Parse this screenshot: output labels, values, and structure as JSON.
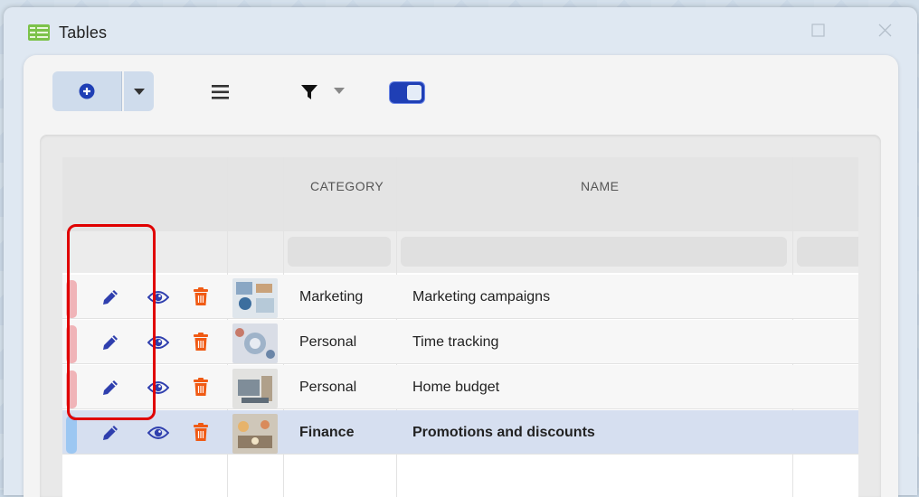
{
  "window": {
    "title": "Tables"
  },
  "grid": {
    "columns": [
      {
        "id": "category",
        "label": "CATEGORY"
      },
      {
        "id": "name",
        "label": "NAME"
      }
    ],
    "rows": [
      {
        "category": "Marketing",
        "name": "Marketing campaigns",
        "status_color": "#f0b4b8",
        "selected": false
      },
      {
        "category": "Personal",
        "name": "Time tracking",
        "status_color": "#f0b4b8",
        "selected": false
      },
      {
        "category": "Personal",
        "name": "Home budget",
        "status_color": "#f0b4b8",
        "selected": false
      },
      {
        "category": "Finance",
        "name": "Promotions and discounts",
        "status_color": "#9cc7f2",
        "selected": true
      }
    ]
  },
  "icons": {
    "add": "plus-circle-icon",
    "dropdown": "caret-down-icon",
    "menu": "hamburger-icon",
    "filter": "funnel-icon",
    "toggle": "toggle-icon",
    "edit": "pencil-icon",
    "view": "eye-icon",
    "delete": "trash-icon"
  },
  "colors": {
    "accent": "#2f3fae",
    "delete": "#f05a14",
    "highlight": "#e00000"
  }
}
